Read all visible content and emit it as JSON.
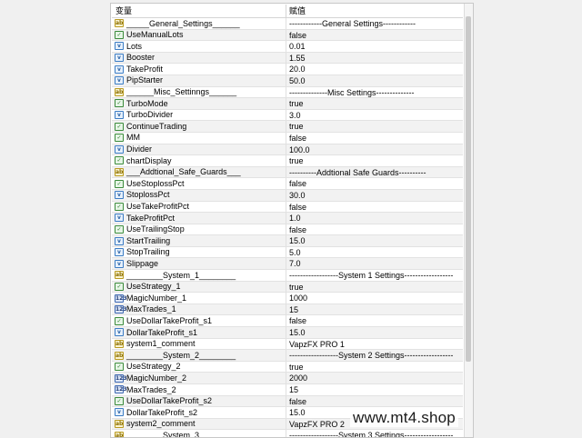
{
  "header": {
    "variable_label": "变量",
    "value_label": "赋值"
  },
  "rows": [
    {
      "icon": "str",
      "name": "_____General_Settings______",
      "value": "------------General Settings------------"
    },
    {
      "icon": "bool",
      "name": "UseManualLots",
      "value": "false"
    },
    {
      "icon": "dbl",
      "name": "Lots",
      "value": "0.01"
    },
    {
      "icon": "dbl",
      "name": "Booster",
      "value": "1.55"
    },
    {
      "icon": "dbl",
      "name": "TakeProfit",
      "value": "20.0"
    },
    {
      "icon": "dbl",
      "name": "PipStarter",
      "value": "50.0"
    },
    {
      "icon": "str",
      "name": "______Misc_Settinngs______",
      "value": "--------------Misc Settings--------------"
    },
    {
      "icon": "bool",
      "name": "TurboMode",
      "value": "true"
    },
    {
      "icon": "dbl",
      "name": "TurboDivider",
      "value": "3.0"
    },
    {
      "icon": "bool",
      "name": "ContinueTrading",
      "value": "true"
    },
    {
      "icon": "bool",
      "name": "MM",
      "value": "false"
    },
    {
      "icon": "dbl",
      "name": "Divider",
      "value": "100.0"
    },
    {
      "icon": "bool",
      "name": "chartDisplay",
      "value": "true"
    },
    {
      "icon": "str",
      "name": "___Addtional_Safe_Guards___",
      "value": "----------Addtional Safe Guards----------"
    },
    {
      "icon": "bool",
      "name": "UseStoplossPct",
      "value": "false"
    },
    {
      "icon": "dbl",
      "name": "StoplossPct",
      "value": "30.0"
    },
    {
      "icon": "bool",
      "name": "UseTakeProfitPct",
      "value": "false"
    },
    {
      "icon": "dbl",
      "name": "TakeProfitPct",
      "value": "1.0"
    },
    {
      "icon": "bool",
      "name": "UseTrailingStop",
      "value": "false"
    },
    {
      "icon": "dbl",
      "name": "StartTrailing",
      "value": "15.0"
    },
    {
      "icon": "dbl",
      "name": "StopTrailing",
      "value": "5.0"
    },
    {
      "icon": "dbl",
      "name": "Slippage",
      "value": "7.0"
    },
    {
      "icon": "str",
      "name": "________System_1________",
      "value": "------------------System 1 Settings------------------"
    },
    {
      "icon": "bool",
      "name": "UseStrategy_1",
      "value": "true"
    },
    {
      "icon": "int",
      "name": "MagicNumber_1",
      "value": "1000"
    },
    {
      "icon": "int",
      "name": "MaxTrades_1",
      "value": "15"
    },
    {
      "icon": "bool",
      "name": "UseDollarTakeProfit_s1",
      "value": "false"
    },
    {
      "icon": "dbl",
      "name": "DollarTakeProfit_s1",
      "value": "15.0"
    },
    {
      "icon": "str",
      "name": "system1_comment",
      "value": "VapzFX PRO 1"
    },
    {
      "icon": "str",
      "name": "________System_2________",
      "value": "------------------System 2 Settings------------------"
    },
    {
      "icon": "bool",
      "name": "UseStrategy_2",
      "value": "true"
    },
    {
      "icon": "int",
      "name": "MagicNumber_2",
      "value": "2000"
    },
    {
      "icon": "int",
      "name": "MaxTrades_2",
      "value": "15"
    },
    {
      "icon": "bool",
      "name": "UseDollarTakeProfit_s2",
      "value": "false"
    },
    {
      "icon": "dbl",
      "name": "DollarTakeProfit_s2",
      "value": "15.0"
    },
    {
      "icon": "str",
      "name": "system2_comment",
      "value": "VapzFX PRO 2"
    },
    {
      "icon": "str",
      "name": "________System_3________",
      "value": "------------------System 3 Settings------------------"
    }
  ],
  "icon_glyphs": {
    "bool": "✓",
    "dbl": "v",
    "str": "ab",
    "int": "123"
  },
  "watermark": "www.mt4.shop"
}
